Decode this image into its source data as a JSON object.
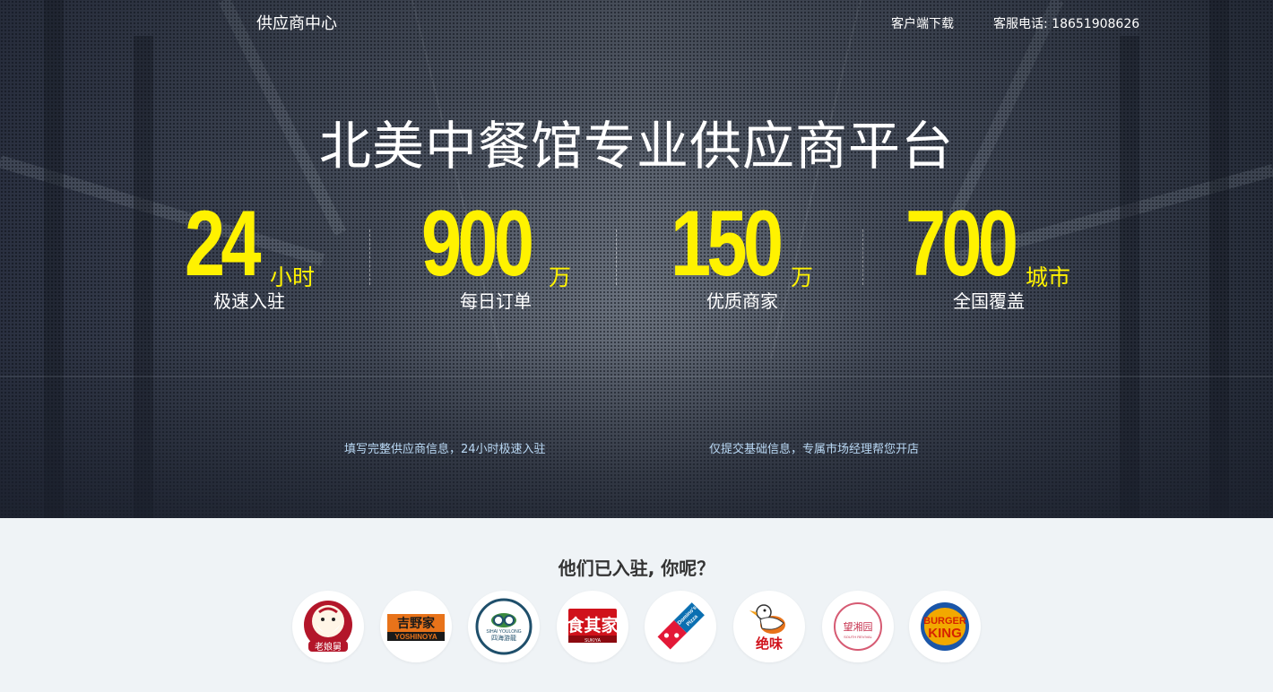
{
  "header": {
    "brand": "供应商中心",
    "download_label": "客户端下载",
    "service_phone": "客服电话: 18651908626"
  },
  "hero": {
    "headline": "北美中餐馆专业供应商平台",
    "stats": [
      {
        "value": "24",
        "unit": "小时",
        "label": "极速入驻"
      },
      {
        "value": "900",
        "unit": "万",
        "label": "每日订单"
      },
      {
        "value": "150",
        "unit": "万",
        "label": "优质商家"
      },
      {
        "value": "700",
        "unit": "城市",
        "label": "全国覆盖"
      }
    ],
    "taglines": [
      "填写完整供应商信息，24小时极速入驻",
      "仅提交基础信息，专属市场经理帮您开店"
    ],
    "accent_color": "#fff200",
    "tagline_color": "#b9d8f4"
  },
  "partners": {
    "title": "他们已入驻, 你呢？",
    "logos": [
      {
        "name": "老娘舅",
        "icon": "laoniangjiu-logo"
      },
      {
        "name": "吉野家 YOSHINOYA",
        "icon": "yoshinoya-logo"
      },
      {
        "name": "四海游龙",
        "icon": "sihaiyoulong-logo"
      },
      {
        "name": "食其家 SUKIYA",
        "icon": "sukiya-logo"
      },
      {
        "name": "Domino's Pizza",
        "icon": "dominos-logo"
      },
      {
        "name": "绝味",
        "icon": "juewei-logo"
      },
      {
        "name": "望湘园",
        "icon": "wangxiangyuan-logo"
      },
      {
        "name": "BURGER KING",
        "icon": "burger-king-logo"
      }
    ]
  }
}
